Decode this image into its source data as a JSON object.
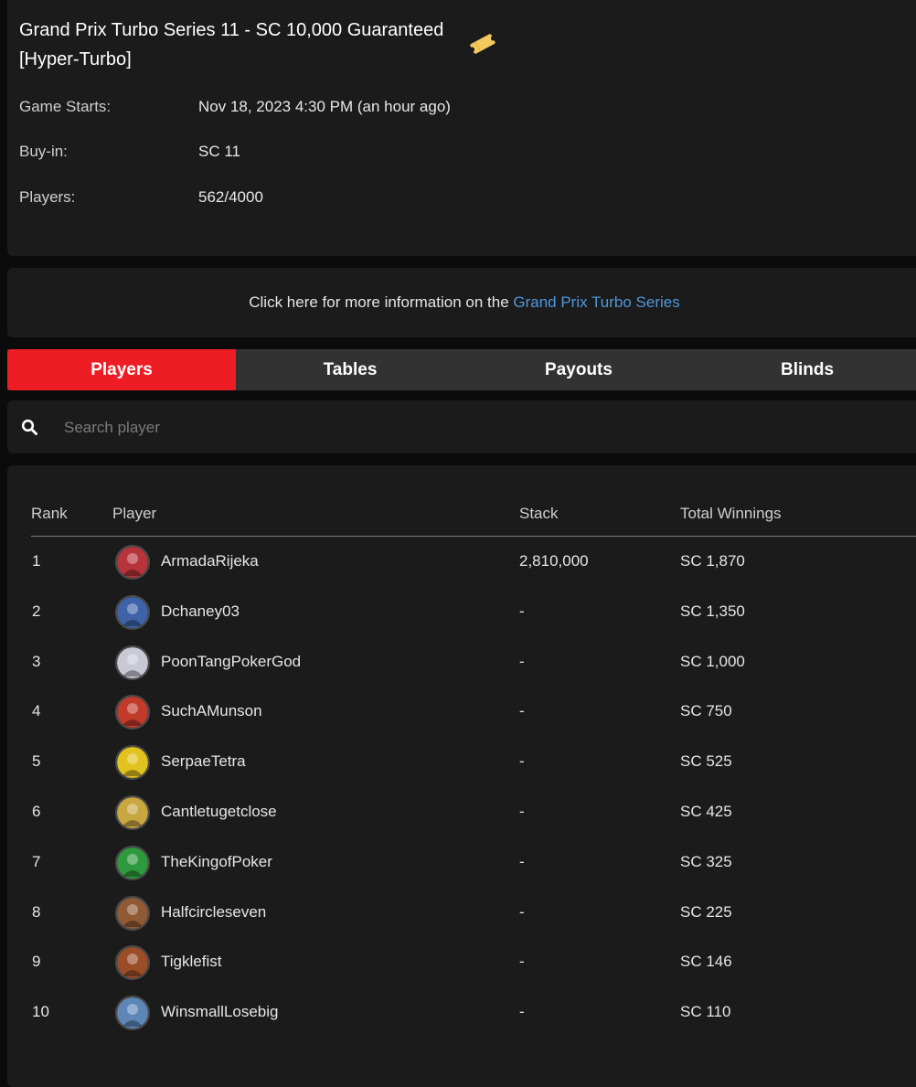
{
  "tournament": {
    "title": "Grand Prix Turbo Series 11 - SC 10,000 Guaranteed [Hyper-Turbo]",
    "icon": "ticket-icon",
    "game_starts_label": "Game Starts:",
    "game_starts_value": "Nov 18, 2023 4:30 PM (an hour ago)",
    "buyin_label": "Buy-in:",
    "buyin_value": "SC 11",
    "players_label": "Players:",
    "players_value": "562/4000"
  },
  "more_info": {
    "text": "Click here for more information on the ",
    "link": "Grand Prix Turbo Series"
  },
  "tabs": [
    {
      "label": "Players",
      "active": true
    },
    {
      "label": "Tables",
      "active": false
    },
    {
      "label": "Payouts",
      "active": false
    },
    {
      "label": "Blinds",
      "active": false
    }
  ],
  "search": {
    "placeholder": "Search player",
    "value": "",
    "icon": "search-icon"
  },
  "table": {
    "headers": {
      "rank": "Rank",
      "player": "Player",
      "stack": "Stack",
      "winnings": "Total Winnings"
    },
    "rows": [
      {
        "rank": "1",
        "player": "ArmadaRijeka",
        "stack": "2,810,000",
        "winnings": "SC 1,870",
        "avatar_color": "#b7343a"
      },
      {
        "rank": "2",
        "player": "Dchaney03",
        "stack": "-",
        "winnings": "SC 1,350",
        "avatar_color": "#3e63a8"
      },
      {
        "rank": "3",
        "player": "PoonTangPokerGod",
        "stack": "-",
        "winnings": "SC 1,000",
        "avatar_color": "#c9c9d6"
      },
      {
        "rank": "4",
        "player": "SuchAMunson",
        "stack": "-",
        "winnings": "SC 750",
        "avatar_color": "#c23a2a"
      },
      {
        "rank": "5",
        "player": "SerpaeTetra",
        "stack": "-",
        "winnings": "SC 525",
        "avatar_color": "#e2c21e"
      },
      {
        "rank": "6",
        "player": "Cantletugetclose",
        "stack": "-",
        "winnings": "SC 425",
        "avatar_color": "#c8a640"
      },
      {
        "rank": "7",
        "player": "TheKingofPoker",
        "stack": "-",
        "winnings": "SC 325",
        "avatar_color": "#2f9a3d"
      },
      {
        "rank": "8",
        "player": "Halfcircleseven",
        "stack": "-",
        "winnings": "SC 225",
        "avatar_color": "#8f5a34"
      },
      {
        "rank": "9",
        "player": "Tigklefist",
        "stack": "-",
        "winnings": "SC 146",
        "avatar_color": "#9b4d28"
      },
      {
        "rank": "10",
        "player": "WinsmallLosebig",
        "stack": "-",
        "winnings": "SC 110",
        "avatar_color": "#5e87b8"
      }
    ]
  },
  "colors": {
    "accent_red": "#ee1c25",
    "link_blue": "#4f97dc",
    "card_bg": "#1b1b1b",
    "page_bg": "#0b0b0b"
  }
}
